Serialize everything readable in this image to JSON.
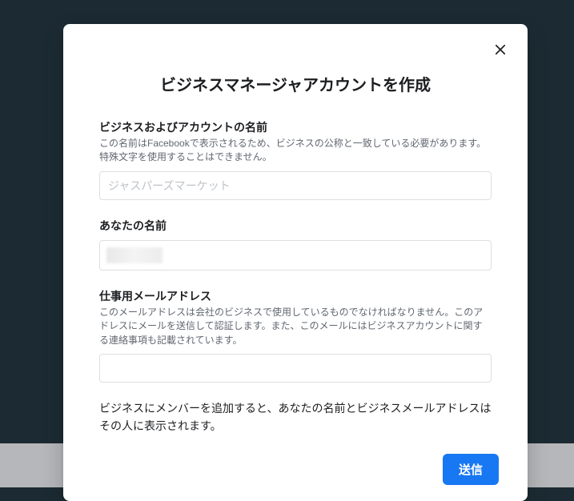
{
  "modal": {
    "title": "ビジネスマネージャアカウントを作成",
    "fields": {
      "business": {
        "label": "ビジネスおよびアカウントの名前",
        "desc": "この名前はFacebookで表示されるため、ビジネスの公称と一致している必要があります。特殊文字を使用することはできません。",
        "placeholder": "ジャスパーズマーケット"
      },
      "name": {
        "label": "あなたの名前",
        "value": ""
      },
      "email": {
        "label": "仕事用メールアドレス",
        "desc": "このメールアドレスは会社のビジネスで使用しているものでなければなりません。このアドレスにメールを送信して認証します。また、このメールにはビジネスアカウントに関する連絡事項も記載されています。"
      }
    },
    "notice": "ビジネスにメンバーを追加すると、あなたの名前とビジネスメールアドレスはその人に表示されます。",
    "submit": "送信"
  }
}
